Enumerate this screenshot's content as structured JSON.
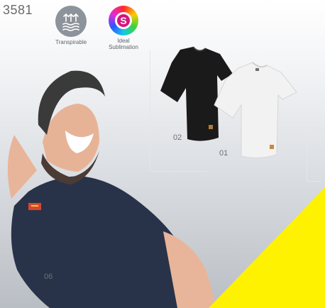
{
  "product_code": "3581",
  "features": {
    "breathable": {
      "icon": "water-vapour-icon",
      "label": "Transpirable"
    },
    "sublimation": {
      "icon": "sublimation-s-icon",
      "label_line1": "Ideal",
      "label_line2": "Sublimation"
    }
  },
  "variants": {
    "black": "02",
    "white": "01",
    "navy": "06"
  },
  "colors": {
    "accent_yellow": "#fff200",
    "navy_shirt": "#28334a",
    "black_shirt": "#1b1a1a",
    "white_shirt": "#f2f2f2"
  }
}
